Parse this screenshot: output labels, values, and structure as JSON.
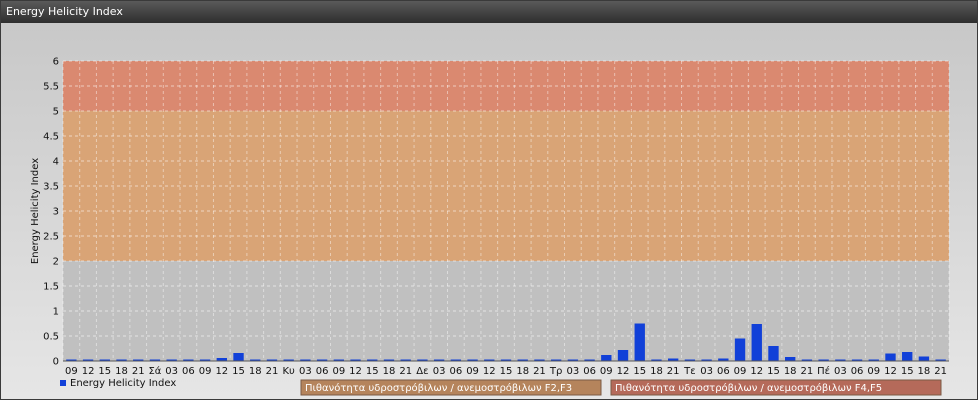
{
  "window": {
    "title": "Energy Helicity Index"
  },
  "chart_data": {
    "type": "bar",
    "title": "",
    "xlabel": "",
    "ylabel": "Energy Helicity Index",
    "ylim": [
      0,
      6
    ],
    "yticks": [
      "0",
      "0.5",
      "1",
      "1.5",
      "2",
      "2.5",
      "3",
      "3.5",
      "4",
      "4.5",
      "5",
      "5.5",
      "6"
    ],
    "grid": true,
    "categories": [
      "09",
      "12",
      "15",
      "18",
      "21",
      "Σά",
      "03",
      "06",
      "09",
      "12",
      "15",
      "18",
      "21",
      "Κυ",
      "03",
      "06",
      "09",
      "12",
      "15",
      "18",
      "21",
      "Δε",
      "03",
      "06",
      "09",
      "12",
      "15",
      "18",
      "21",
      "Τρ",
      "03",
      "06",
      "09",
      "12",
      "15",
      "18",
      "21",
      "Τε",
      "03",
      "06",
      "09",
      "12",
      "15",
      "18",
      "21",
      "Πέ",
      "03",
      "06",
      "09",
      "12",
      "15",
      "18",
      "21"
    ],
    "series": [
      {
        "name": "Energy Helicity Index",
        "color": "#1140d8",
        "values": [
          0.01,
          0.01,
          0.01,
          0.01,
          0.01,
          0.01,
          0.01,
          0.01,
          0.01,
          0.06,
          0.16,
          0.01,
          0.01,
          0.01,
          0.01,
          0.01,
          0.01,
          0.01,
          0.01,
          0.01,
          0.01,
          0.01,
          0.01,
          0.01,
          0.01,
          0.01,
          0.01,
          0.01,
          0.01,
          0.01,
          0.01,
          0.01,
          0.12,
          0.22,
          0.75,
          0.02,
          0.05,
          0.03,
          0.01,
          0.05,
          0.45,
          0.74,
          0.3,
          0.08,
          0.01,
          0.01,
          0.01,
          0.01,
          0.02,
          0.15,
          0.18,
          0.09,
          0.02
        ]
      }
    ],
    "bands": [
      {
        "from": 0,
        "to": 2,
        "color": "#c0c0c0"
      },
      {
        "from": 2,
        "to": 5,
        "color": "#d9a476"
      },
      {
        "from": 5,
        "to": 6,
        "color": "#da8970"
      }
    ],
    "legend": {
      "position": "bottom-left"
    },
    "band_labels": [
      {
        "text": "Πιθανότητα υδροστρόβιλων / ανεμοστρόβιλων F2,F3",
        "color": "#b5845c"
      },
      {
        "text": "Πιθανότητα υδροστρόβιλων / ανεμοστρόβιλων F4,F5",
        "color": "#b56a5a"
      }
    ]
  }
}
